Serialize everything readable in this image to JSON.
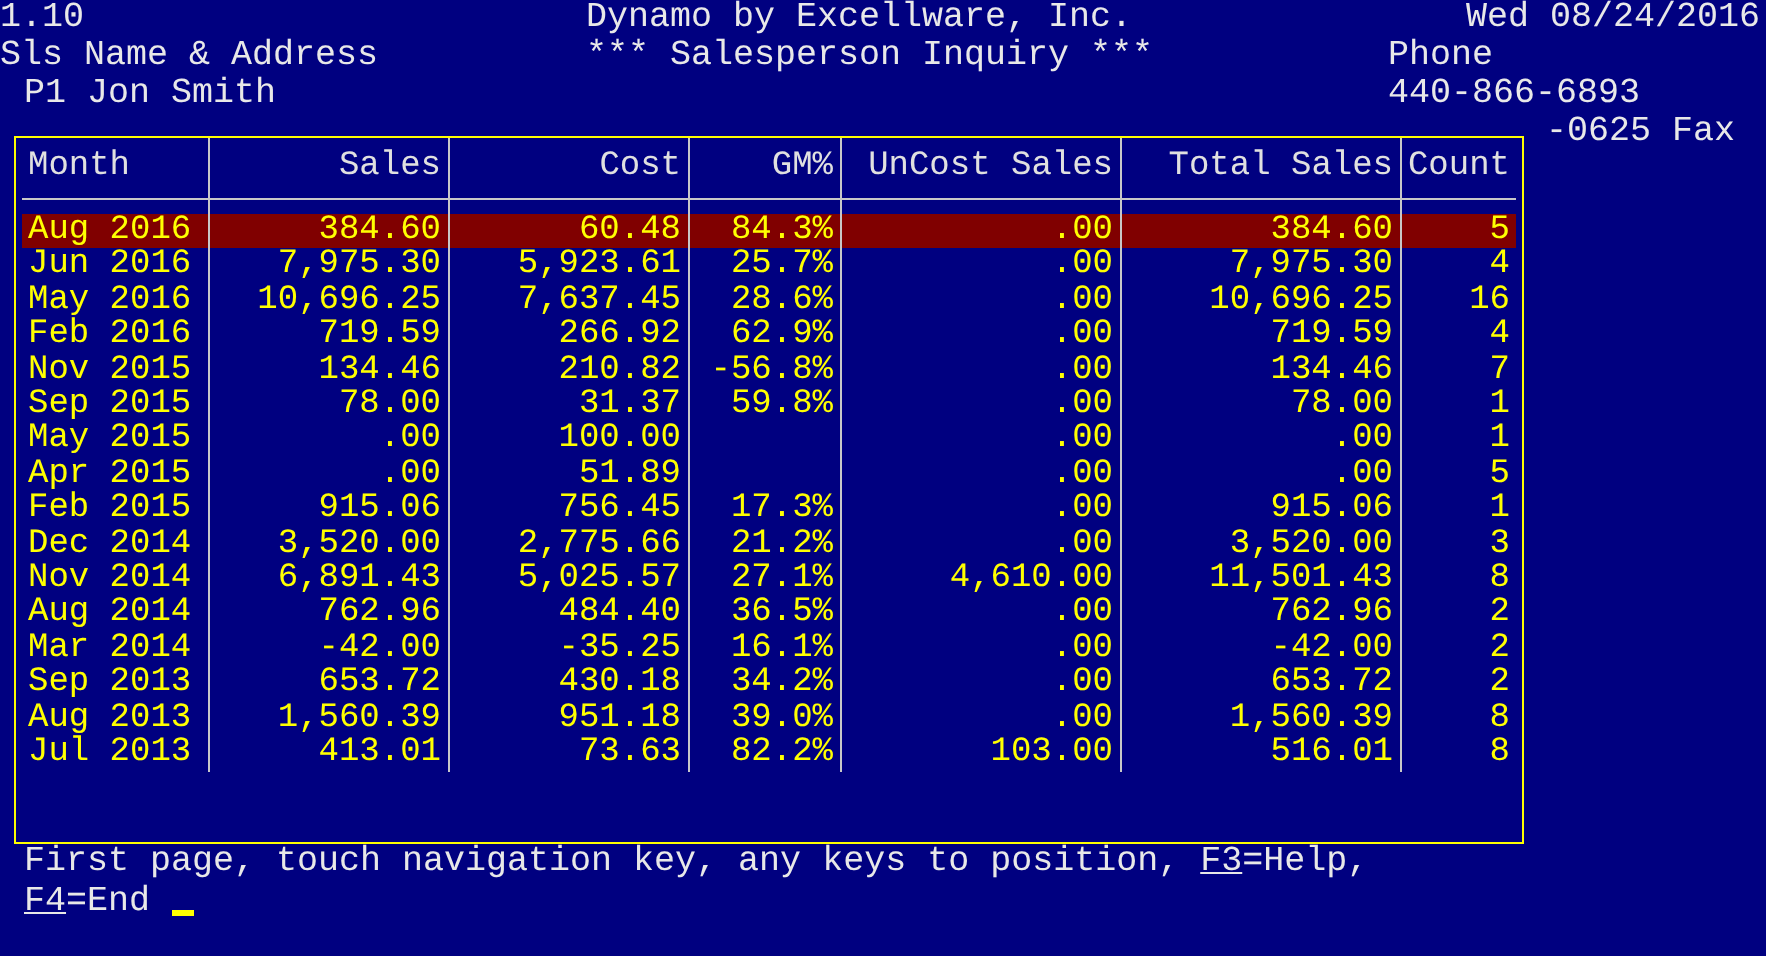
{
  "header": {
    "version": "1.10",
    "company": "Dynamo by Excellware, Inc.",
    "date": "Wed 08/24/2016",
    "section_label": "Sls Name & Address",
    "screen_title": "*** Salesperson Inquiry ***",
    "phone_label": "Phone",
    "salesperson": "P1 Jon Smith",
    "phone": "440-866-6893",
    "fax": "-0625 Fax"
  },
  "table": {
    "columns": [
      "Month",
      "Sales",
      "Cost",
      "GM%",
      "UnCost Sales",
      "Total Sales",
      "Count"
    ],
    "rows": [
      {
        "month": "Aug 2016",
        "sales": "384.60",
        "cost": "60.48",
        "gm": "84.3%",
        "uncost": ".00",
        "total": "384.60",
        "count": "5",
        "selected": true
      },
      {
        "month": "Jun 2016",
        "sales": "7,975.30",
        "cost": "5,923.61",
        "gm": "25.7%",
        "uncost": ".00",
        "total": "7,975.30",
        "count": "4",
        "selected": false
      },
      {
        "month": "May 2016",
        "sales": "10,696.25",
        "cost": "7,637.45",
        "gm": "28.6%",
        "uncost": ".00",
        "total": "10,696.25",
        "count": "16",
        "selected": false
      },
      {
        "month": "Feb 2016",
        "sales": "719.59",
        "cost": "266.92",
        "gm": "62.9%",
        "uncost": ".00",
        "total": "719.59",
        "count": "4",
        "selected": false
      },
      {
        "month": "Nov 2015",
        "sales": "134.46",
        "cost": "210.82",
        "gm": "-56.8%",
        "uncost": ".00",
        "total": "134.46",
        "count": "7",
        "selected": false
      },
      {
        "month": "Sep 2015",
        "sales": "78.00",
        "cost": "31.37",
        "gm": "59.8%",
        "uncost": ".00",
        "total": "78.00",
        "count": "1",
        "selected": false
      },
      {
        "month": "May 2015",
        "sales": ".00",
        "cost": "100.00",
        "uncost": ".00",
        "total": ".00",
        "count": "1",
        "selected": false
      },
      {
        "month": "Apr 2015",
        "sales": ".00",
        "cost": "51.89",
        "uncost": ".00",
        "total": ".00",
        "count": "5",
        "selected": false
      },
      {
        "month": "Feb 2015",
        "sales": "915.06",
        "cost": "756.45",
        "gm": "17.3%",
        "uncost": ".00",
        "total": "915.06",
        "count": "1",
        "selected": false
      },
      {
        "month": "Dec 2014",
        "sales": "3,520.00",
        "cost": "2,775.66",
        "gm": "21.2%",
        "uncost": ".00",
        "total": "3,520.00",
        "count": "3",
        "selected": false
      },
      {
        "month": "Nov 2014",
        "sales": "6,891.43",
        "cost": "5,025.57",
        "gm": "27.1%",
        "uncost": "4,610.00",
        "total": "11,501.43",
        "count": "8",
        "selected": false
      },
      {
        "month": "Aug 2014",
        "sales": "762.96",
        "cost": "484.40",
        "gm": "36.5%",
        "uncost": ".00",
        "total": "762.96",
        "count": "2",
        "selected": false
      },
      {
        "month": "Mar 2014",
        "sales": "-42.00",
        "cost": "-35.25",
        "gm": "16.1%",
        "uncost": ".00",
        "total": "-42.00",
        "count": "2",
        "selected": false
      },
      {
        "month": "Sep 2013",
        "sales": "653.72",
        "cost": "430.18",
        "gm": "34.2%",
        "uncost": ".00",
        "total": "653.72",
        "count": "2",
        "selected": false
      },
      {
        "month": "Aug 2013",
        "sales": "1,560.39",
        "cost": "951.18",
        "gm": "39.0%",
        "uncost": ".00",
        "total": "1,560.39",
        "count": "8",
        "selected": false
      },
      {
        "month": "Jul 2013",
        "sales": "413.01",
        "cost": "73.63",
        "gm": "82.2%",
        "uncost": "103.00",
        "total": "516.01",
        "count": "8",
        "selected": false
      }
    ]
  },
  "footer": {
    "message": "First page, touch navigation key, any keys to position,",
    "keys": [
      {
        "key": "F3",
        "action": "=Help,"
      },
      {
        "key": "F4",
        "action": "=End"
      }
    ]
  }
}
